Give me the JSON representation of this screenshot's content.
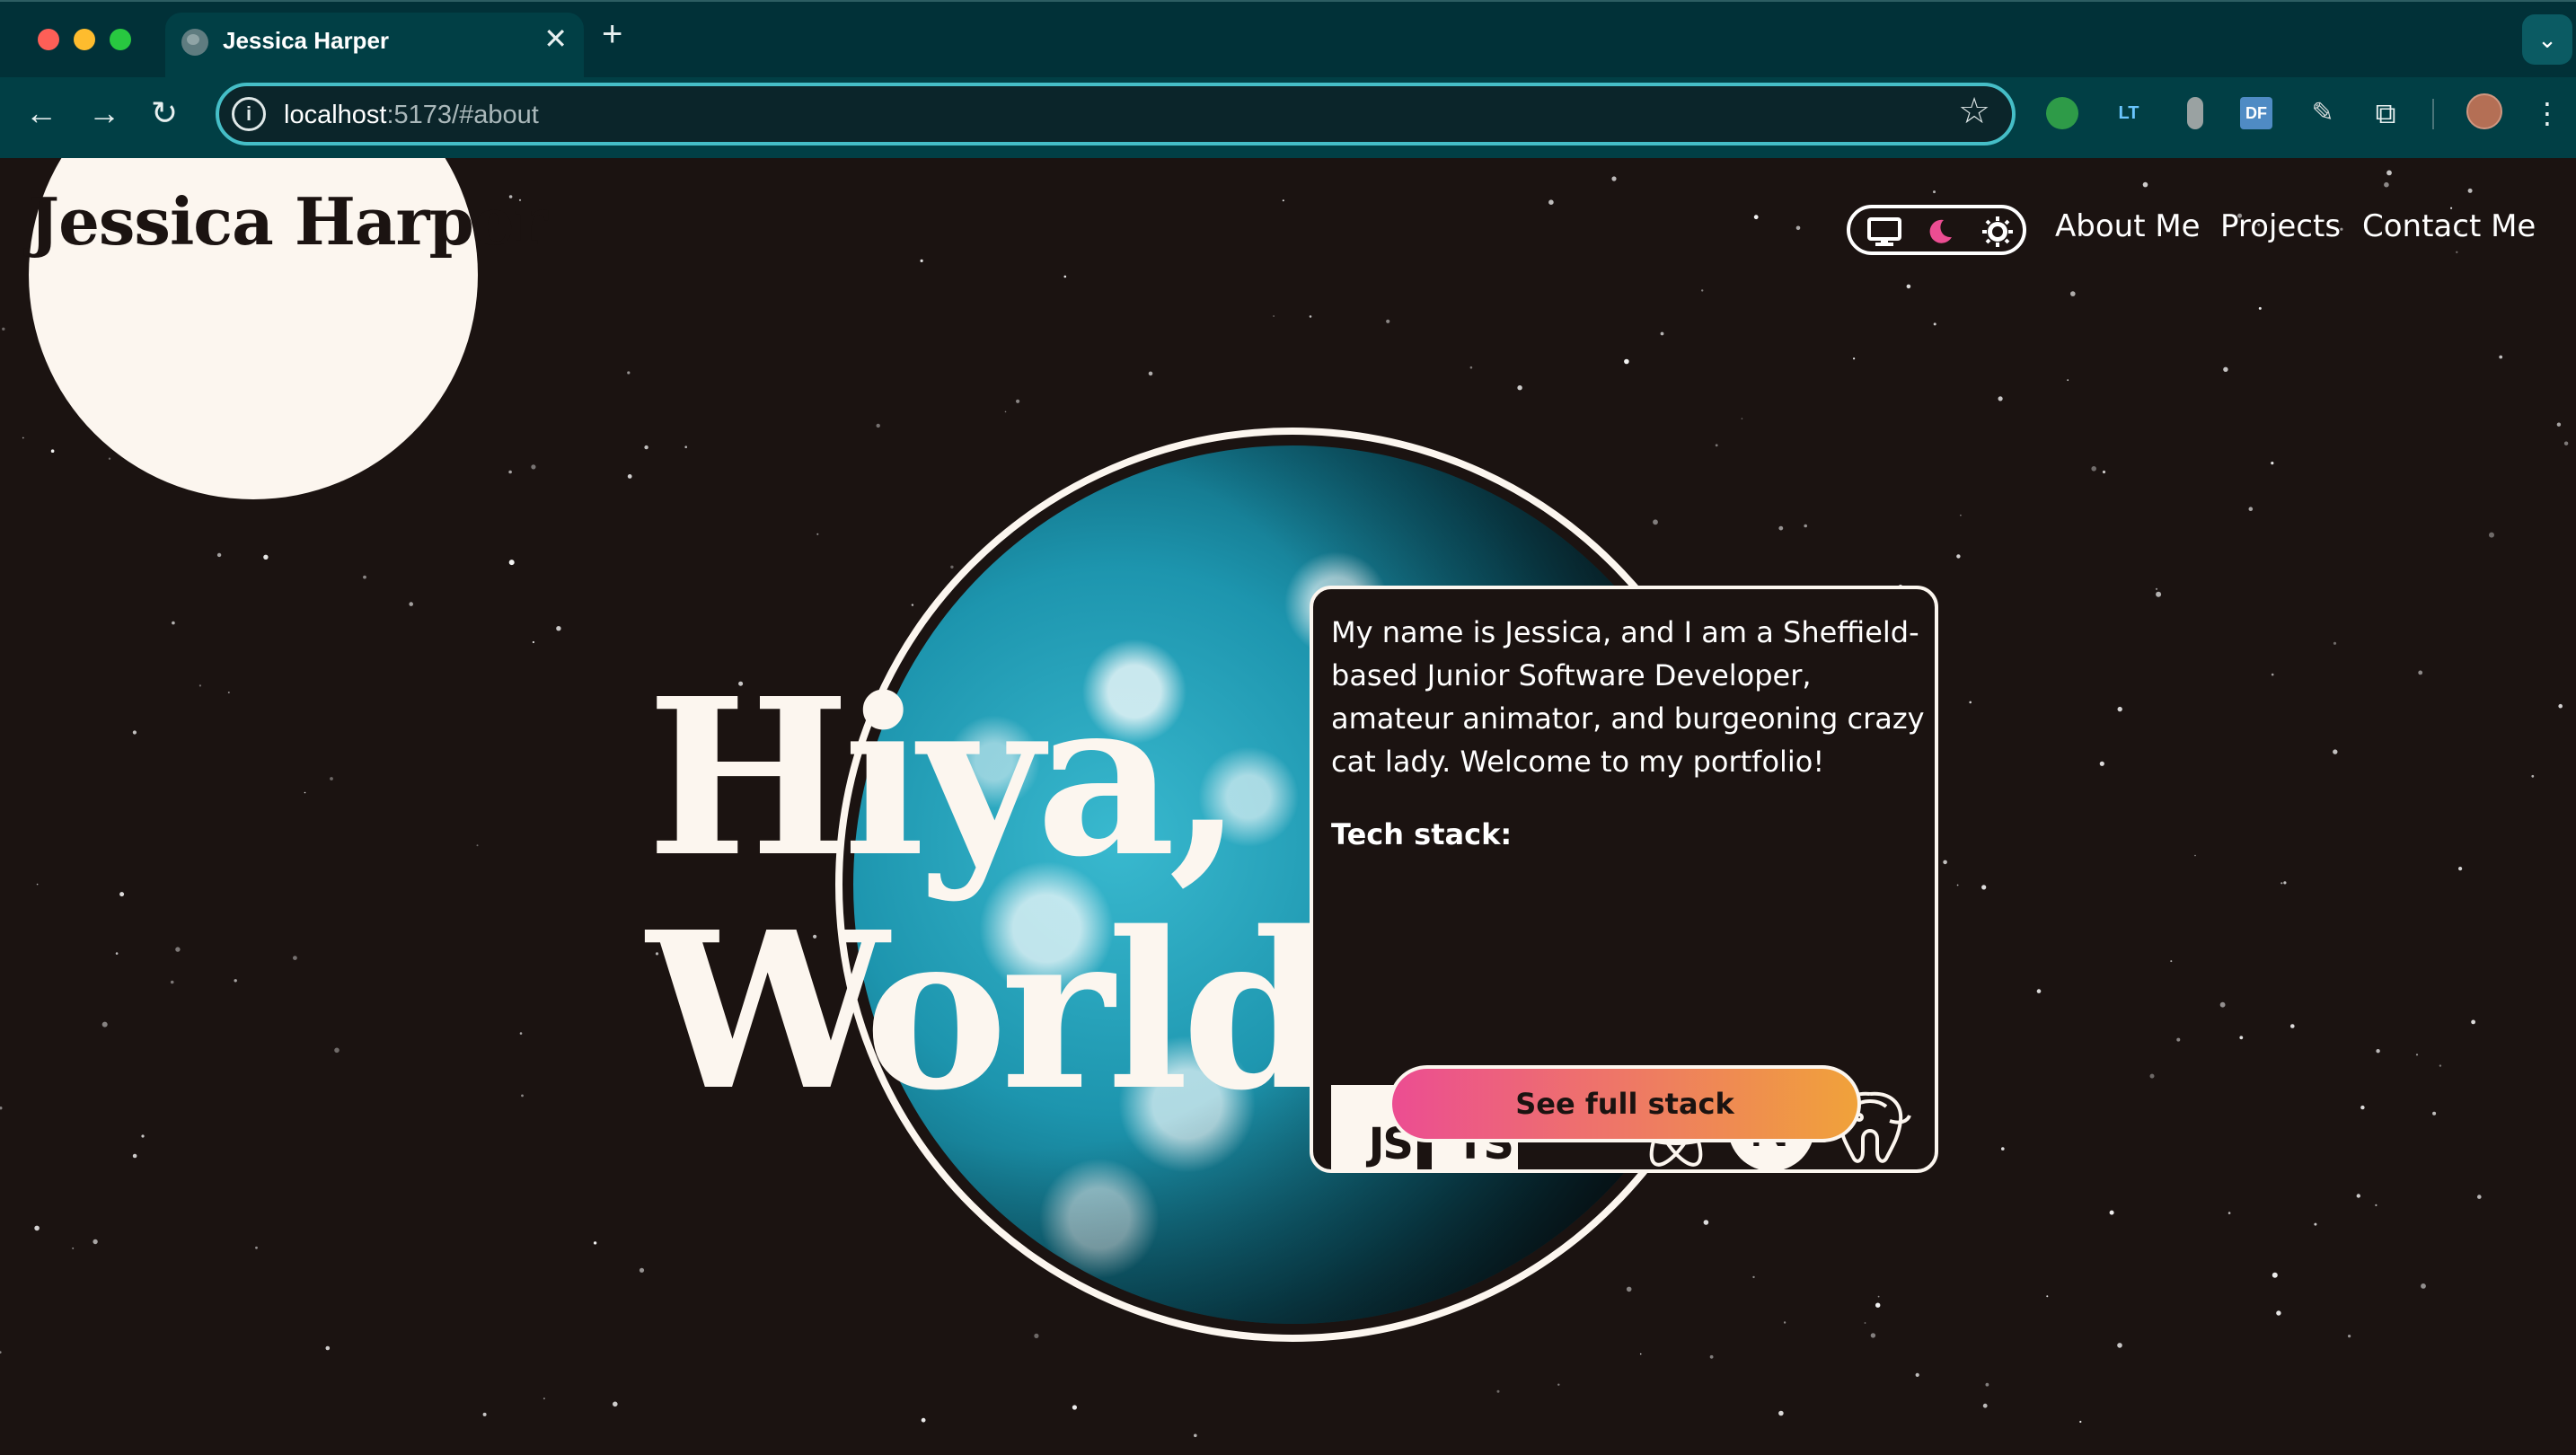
{
  "browser": {
    "tab_title": "Jessica Harper",
    "tab_close": "✕",
    "new_tab": "+",
    "url_host": "localhost",
    "url_rest": ":5173/#about",
    "tab_menu_icon": "chevron-down-icon"
  },
  "site": {
    "logo": "Jessica Harper",
    "nav": {
      "about": "About Me",
      "projects": "Projects",
      "contact": "Contact Me"
    },
    "theme_toggle": [
      "monitor-icon",
      "moon-icon",
      "sun-icon"
    ],
    "moon_color": "#ec4d92"
  },
  "hero": {
    "line1": "Hiya,",
    "line2": "World"
  },
  "card": {
    "bio": "My name is Jessica, and I am a Sheffield-based Junior Software Developer, amateur animator, and burgeoning crazy cat lady. Welcome to my portfolio!",
    "stack_title": "Tech stack:",
    "stack_icons": [
      "javascript-icon",
      "typescript-icon",
      "tailwind-icon",
      "react-icon",
      "nextjs-icon",
      "postgresql-icon"
    ],
    "js": "JS",
    "ts": "TS",
    "next": "N",
    "cta": "See full stack"
  },
  "colors": {
    "background": "#1b1311",
    "cream": "#fcf6ef",
    "gradient_start": "#ec4d92",
    "gradient_end": "#f0a23a",
    "chrome": "#013f45"
  }
}
